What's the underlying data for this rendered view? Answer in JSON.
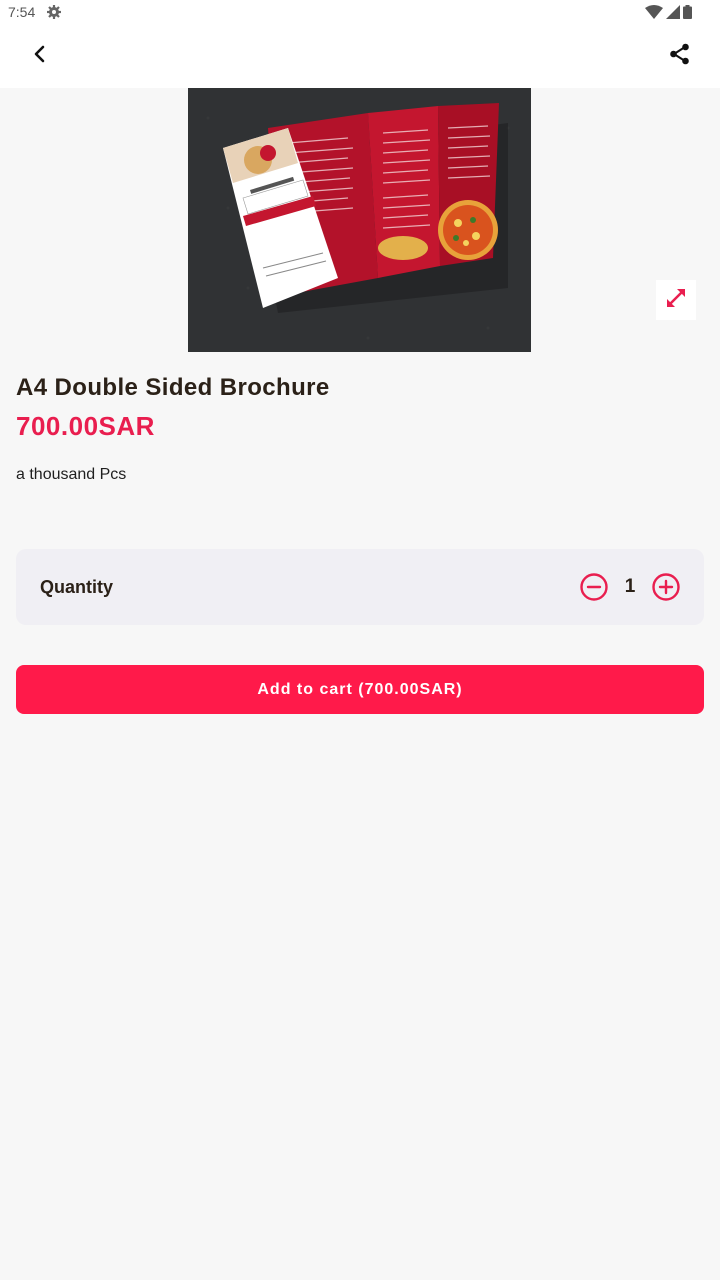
{
  "status_bar": {
    "time": "7:54",
    "icons": [
      "settings-icon",
      "wifi-icon",
      "signal-icon",
      "battery-icon"
    ]
  },
  "app_bar": {
    "back_icon": "chevron-left-icon",
    "share_icon": "share-icon"
  },
  "product": {
    "image_alt": "Tri-fold red restaurant menu brochure",
    "expand_icon": "expand-icon",
    "title": "A4 Double Sided Brochure",
    "price": "700.00SAR",
    "description": "a thousand Pcs"
  },
  "quantity": {
    "label": "Quantity",
    "value": "1",
    "minus_icon": "minus-circle-icon",
    "plus_icon": "plus-circle-icon"
  },
  "cart": {
    "button_label": "Add to cart (700.00SAR)"
  },
  "colors": {
    "accent": "#e91e4f",
    "button": "#ff1a4a",
    "background": "#f7f7f7",
    "card": "#f0eff4"
  }
}
